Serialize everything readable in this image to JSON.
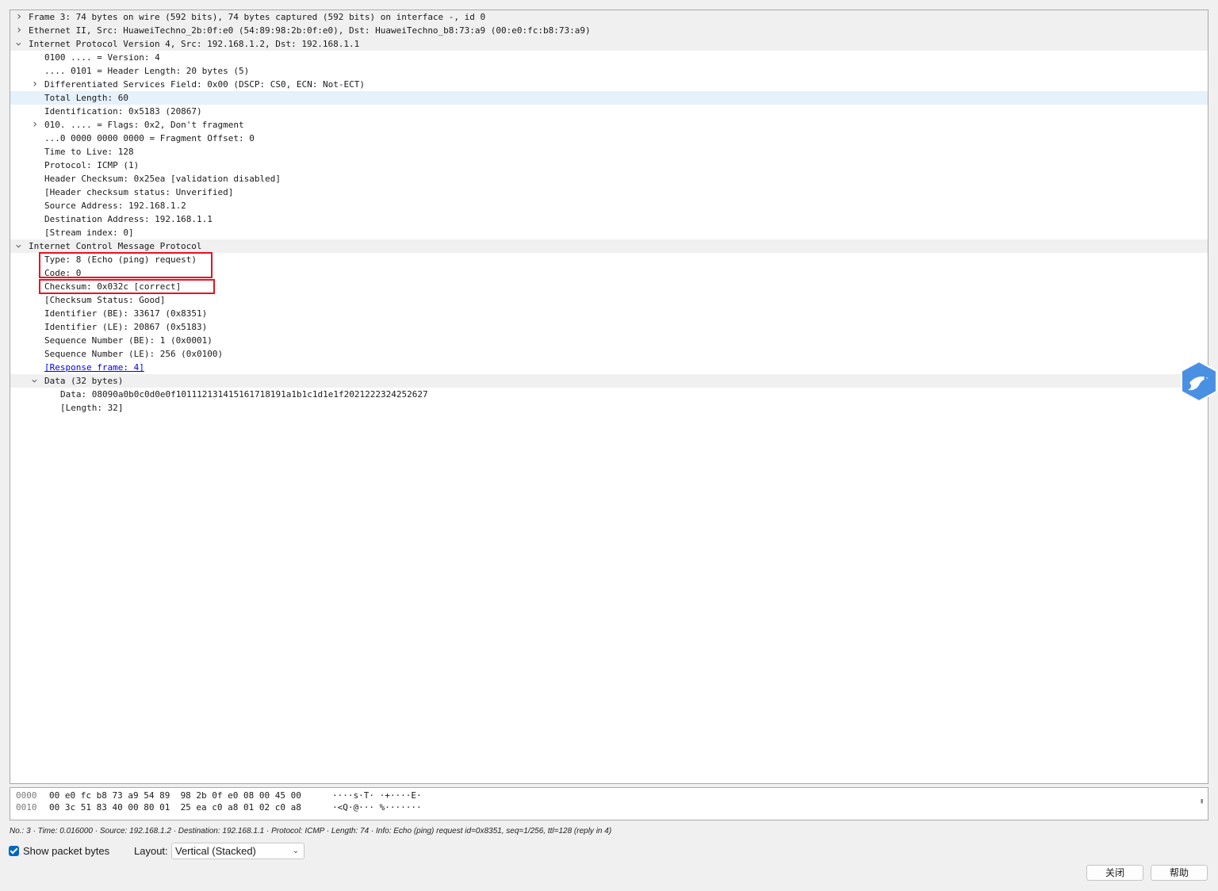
{
  "tree": [
    {
      "text": "Frame 3: 74 bytes on wire (592 bits), 74 bytes captured (592 bits) on interface -, id 0",
      "arrow": "collapsed"
    },
    {
      "text": "Ethernet II, Src: HuaweiTechno_2b:0f:e0 (54:89:98:2b:0f:e0), Dst: HuaweiTechno_b8:73:a9 (00:e0:fc:b8:73:a9)",
      "arrow": "collapsed"
    },
    {
      "text": "Internet Protocol Version 4, Src: 192.168.1.2, Dst: 192.168.1.1",
      "arrow": "expanded"
    },
    {
      "text": "0100 .... = Version: 4"
    },
    {
      "text": ".... 0101 = Header Length: 20 bytes (5)"
    },
    {
      "text": "Differentiated Services Field: 0x00 (DSCP: CS0, ECN: Not-ECT)",
      "arrow": "collapsed"
    },
    {
      "text": "Total Length: 60",
      "selected": true
    },
    {
      "text": "Identification: 0x5183 (20867)"
    },
    {
      "text": "010. .... = Flags: 0x2, Don't fragment",
      "arrow": "collapsed"
    },
    {
      "text": "...0 0000 0000 0000 = Fragment Offset: 0"
    },
    {
      "text": "Time to Live: 128"
    },
    {
      "text": "Protocol: ICMP (1)"
    },
    {
      "text": "Header Checksum: 0x25ea [validation disabled]"
    },
    {
      "text": "[Header checksum status: Unverified]"
    },
    {
      "text": "Source Address: 192.168.1.2"
    },
    {
      "text": "Destination Address: 192.168.1.1"
    },
    {
      "text": "[Stream index: 0]"
    },
    {
      "text": "Internet Control Message Protocol",
      "arrow": "expanded"
    },
    {
      "text": "Type: 8 (Echo (ping) request)"
    },
    {
      "text": "Code: 0"
    },
    {
      "text": "Checksum: 0x032c [correct]"
    },
    {
      "text": "[Checksum Status: Good]"
    },
    {
      "text": "Identifier (BE): 33617 (0x8351)"
    },
    {
      "text": "Identifier (LE): 20867 (0x5183)"
    },
    {
      "text": "Sequence Number (BE): 1 (0x0001)"
    },
    {
      "text": "Sequence Number (LE): 256 (0x0100)"
    },
    {
      "text": "[Response frame: 4]",
      "link": true
    },
    {
      "text": "Data (32 bytes)",
      "arrow": "expanded"
    },
    {
      "text": "Data: 08090a0b0c0d0e0f101112131415161718191a1b1c1d1e1f2021222324252627"
    },
    {
      "text": "[Length: 32]"
    }
  ],
  "bytes": [
    {
      "offset": "0000",
      "hex": "00 e0 fc b8 73 a9 54 89  98 2b 0f e0 08 00 45 00",
      "ascii": "····s·T· ·+····E·"
    },
    {
      "offset": "0010",
      "hex": "00 3c 51 83 40 00 80 01  25 ea c0 a8 01 02 c0 a8",
      "ascii": "·<Q·@··· %·······"
    }
  ],
  "status": "No.: 3 · Time: 0.016000 · Source: 192.168.1.2 · Destination: 192.168.1.1 · Protocol: ICMP · Length: 74 · Info: Echo (ping) request id=0x8351, seq=1/256, ttl=128 (reply in 4)",
  "controls": {
    "show_bytes_label": "Show packet bytes",
    "show_bytes_checked": true,
    "layout_label": "Layout:",
    "layout_value": "Vertical (Stacked)",
    "close_label": "关闭",
    "help_label": "帮助"
  },
  "colors": {
    "highlight_box": "#e81123",
    "selection": "#e5f1fb",
    "header_row": "#f0f0f0",
    "link": "#0000ee",
    "badge": "#4a90e2"
  },
  "icons": [
    "chevron-right-icon",
    "chevron-down-icon",
    "bird-badge-icon",
    "checkmark-icon",
    "dropdown-chevron-icon"
  ]
}
